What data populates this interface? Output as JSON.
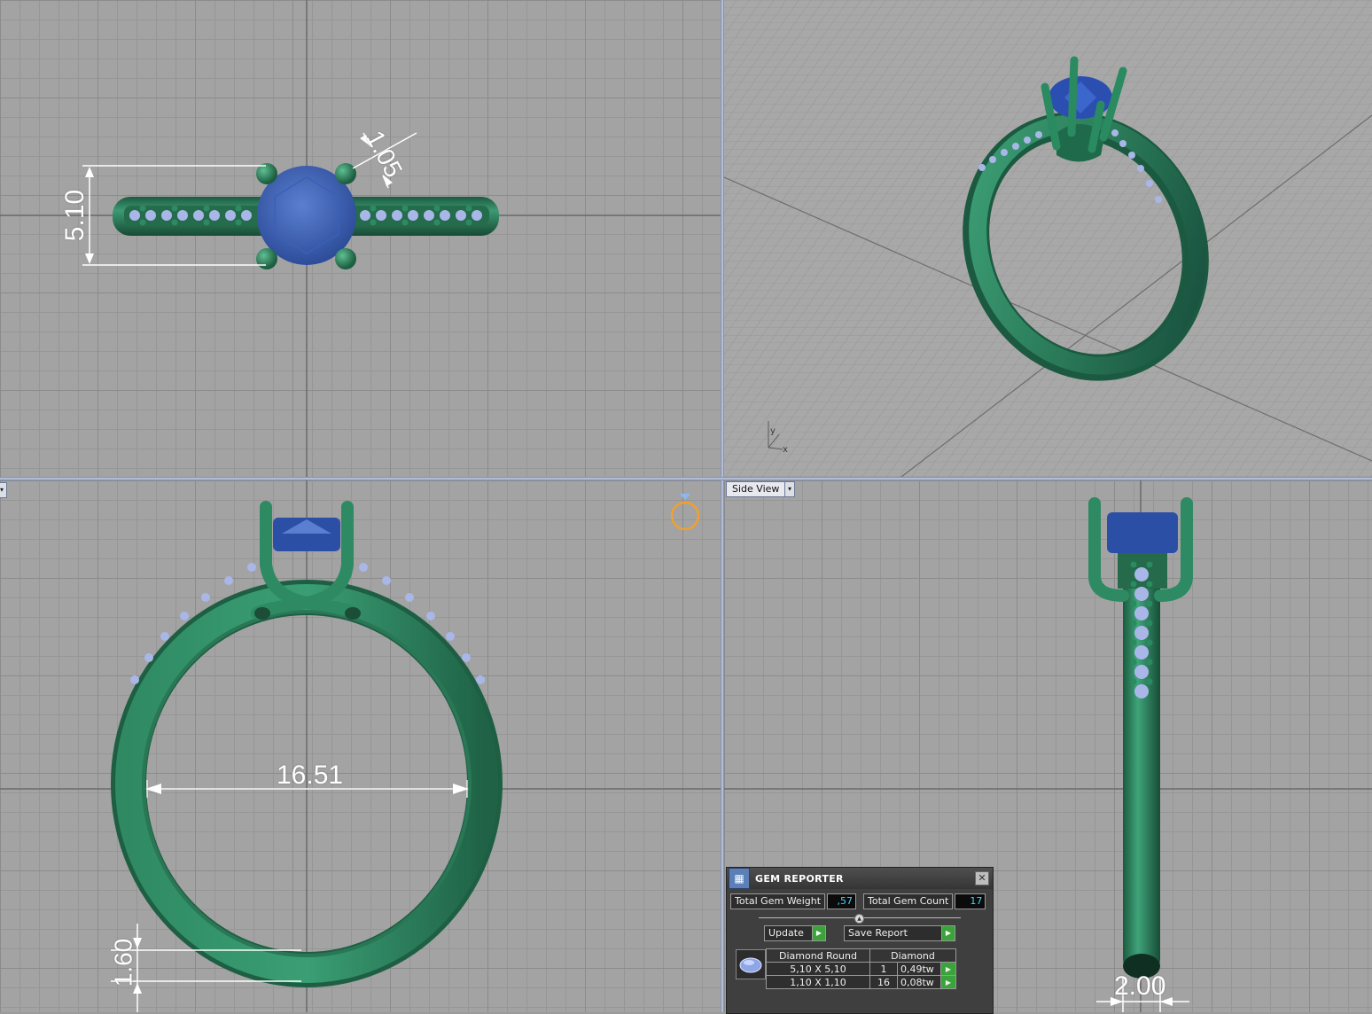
{
  "viewports": {
    "top_view": {
      "dimensions": [
        "5.10",
        "1.05"
      ]
    },
    "perspective_view": {
      "axis_labels": [
        "y",
        "x"
      ]
    },
    "front_view": {
      "dimensions": [
        "16.51",
        "1.60"
      ]
    },
    "side_view": {
      "label": "Side View",
      "dimensions": [
        "2.00"
      ]
    }
  },
  "gem_reporter": {
    "title": "GEM REPORTER",
    "total_weight_label": "Total Gem Weight",
    "total_weight_value": ",57",
    "total_count_label": "Total Gem Count",
    "total_count_value": "17",
    "update_label": "Update",
    "save_report_label": "Save Report",
    "table": {
      "headers": [
        "Diamond Round",
        "Diamond"
      ],
      "rows": [
        {
          "size": "5,10 X 5,10",
          "count": "1",
          "weight": "0,49tw"
        },
        {
          "size": "1,10 X 1,10",
          "count": "16",
          "weight": "0,08tw"
        }
      ]
    }
  },
  "colors": {
    "metal": "#2e7a5a",
    "gem_center": "#2b4ea8",
    "gem_side": "#a9b7e8"
  }
}
